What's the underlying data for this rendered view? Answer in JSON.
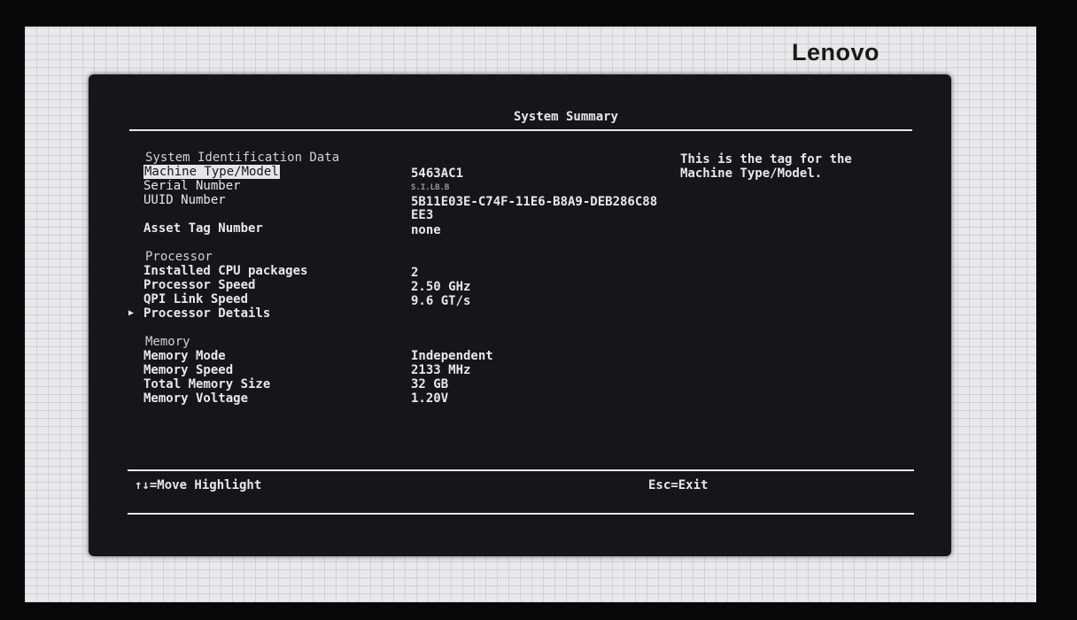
{
  "brand": "Lenovo",
  "screen_title": "System Summary",
  "sections": {
    "identification": {
      "header": "System Identification Data",
      "machine_type_label": "Machine Type/Model",
      "machine_type_value": "5463AC1",
      "serial_label": "Serial Number",
      "serial_value": "S.I.LB.B",
      "uuid_label": "UUID Number",
      "uuid_value_line1": "5B11E03E-C74F-11E6-B8A9-DEB286C88",
      "uuid_value_line2": "EE3",
      "asset_label": "Asset Tag Number",
      "asset_value": "none"
    },
    "processor": {
      "header": "Processor",
      "cpu_packages_label": "Installed CPU packages",
      "cpu_packages_value": "2",
      "speed_label": "Processor Speed",
      "speed_value": "2.50 GHz",
      "qpi_label": "QPI Link Speed",
      "qpi_value": "9.6 GT/s",
      "details_label": "Processor Details"
    },
    "memory": {
      "header": "Memory",
      "mode_label": "Memory Mode",
      "mode_value": "Independent",
      "speed_label": "Memory Speed",
      "speed_value": "2133 MHz",
      "total_label": "Total Memory Size",
      "total_value": "32 GB",
      "voltage_label": "Memory Voltage",
      "voltage_value": "1.20V"
    }
  },
  "help_text": "This is the tag for the\nMachine Type/Model.",
  "footer": {
    "move_hint": "↑↓=Move Highlight",
    "exit_hint": "Esc=Exit"
  },
  "submenu_arrow": "▶"
}
